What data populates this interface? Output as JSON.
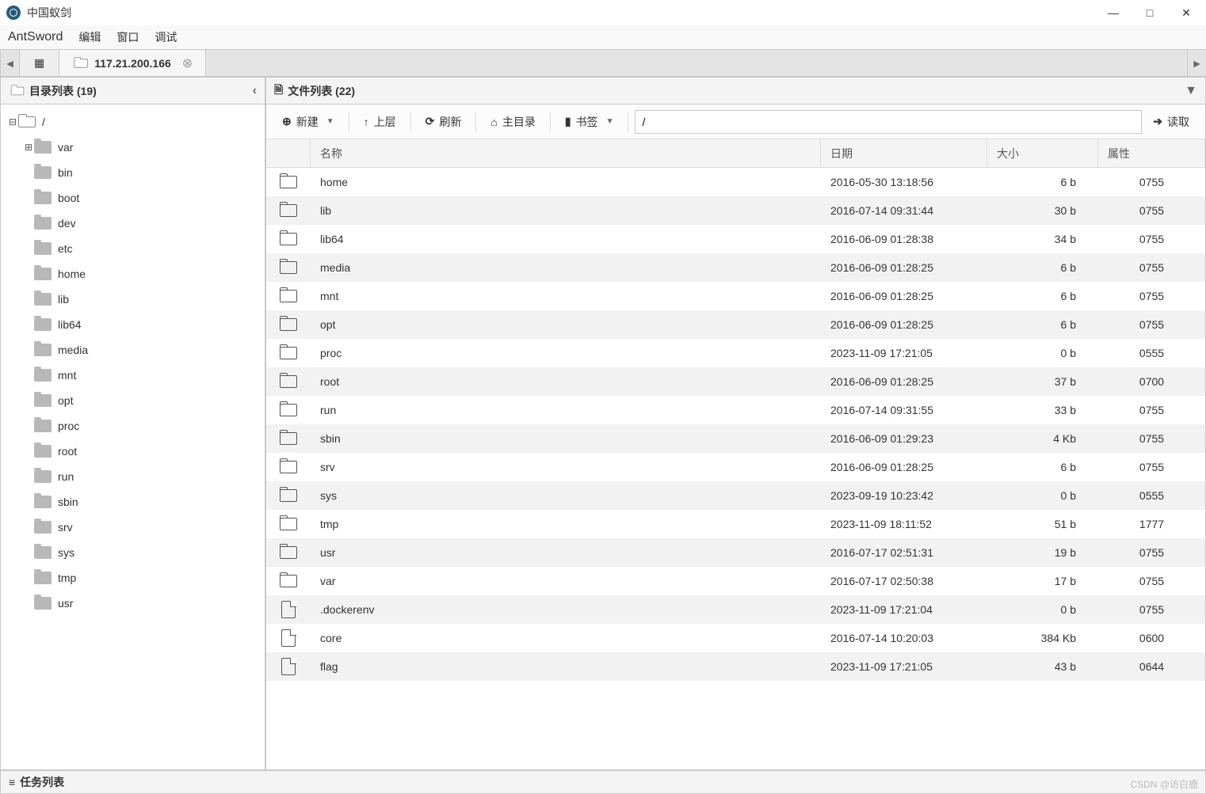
{
  "window": {
    "title": "中国蚁剑",
    "controls": {
      "min": "—",
      "max": "□",
      "close": "✕"
    }
  },
  "menubar": {
    "brand": "AntSword",
    "items": [
      "编辑",
      "窗口",
      "调试"
    ]
  },
  "tabs": {
    "grid_icon": "▦",
    "active": {
      "label": "117.21.200.166"
    },
    "scroll_left": "◄",
    "scroll_right": "►"
  },
  "sidebar": {
    "title": "目录列表 (19)",
    "collapse_glyph": "‹",
    "root": {
      "label": "/",
      "expander": "⊟"
    },
    "items": [
      {
        "label": "var",
        "expander": "⊞"
      },
      {
        "label": "bin"
      },
      {
        "label": "boot"
      },
      {
        "label": "dev"
      },
      {
        "label": "etc"
      },
      {
        "label": "home"
      },
      {
        "label": "lib"
      },
      {
        "label": "lib64"
      },
      {
        "label": "media"
      },
      {
        "label": "mnt"
      },
      {
        "label": "opt"
      },
      {
        "label": "proc"
      },
      {
        "label": "root"
      },
      {
        "label": "run"
      },
      {
        "label": "sbin"
      },
      {
        "label": "srv"
      },
      {
        "label": "sys"
      },
      {
        "label": "tmp"
      },
      {
        "label": "usr"
      }
    ]
  },
  "main": {
    "title": "文件列表 (22)",
    "toolbar": {
      "new": "新建",
      "up": "上层",
      "refresh": "刷新",
      "home": "主目录",
      "bookmark": "书签",
      "path_value": "/",
      "read": "读取",
      "caret": "▼",
      "arrow_right": "➔"
    },
    "columns": {
      "name": "名称",
      "date": "日期",
      "size": "大小",
      "attr": "属性"
    },
    "files": [
      {
        "type": "dir",
        "name": "home",
        "date": "2016-05-30 13:18:56",
        "size": "6 b",
        "attr": "0755"
      },
      {
        "type": "dir",
        "name": "lib",
        "date": "2016-07-14 09:31:44",
        "size": "30 b",
        "attr": "0755"
      },
      {
        "type": "dir",
        "name": "lib64",
        "date": "2016-06-09 01:28:38",
        "size": "34 b",
        "attr": "0755"
      },
      {
        "type": "dir",
        "name": "media",
        "date": "2016-06-09 01:28:25",
        "size": "6 b",
        "attr": "0755"
      },
      {
        "type": "dir",
        "name": "mnt",
        "date": "2016-06-09 01:28:25",
        "size": "6 b",
        "attr": "0755"
      },
      {
        "type": "dir",
        "name": "opt",
        "date": "2016-06-09 01:28:25",
        "size": "6 b",
        "attr": "0755"
      },
      {
        "type": "dir",
        "name": "proc",
        "date": "2023-11-09 17:21:05",
        "size": "0 b",
        "attr": "0555"
      },
      {
        "type": "dir",
        "name": "root",
        "date": "2016-06-09 01:28:25",
        "size": "37 b",
        "attr": "0700"
      },
      {
        "type": "dir",
        "name": "run",
        "date": "2016-07-14 09:31:55",
        "size": "33 b",
        "attr": "0755"
      },
      {
        "type": "dir",
        "name": "sbin",
        "date": "2016-06-09 01:29:23",
        "size": "4 Kb",
        "attr": "0755"
      },
      {
        "type": "dir",
        "name": "srv",
        "date": "2016-06-09 01:28:25",
        "size": "6 b",
        "attr": "0755"
      },
      {
        "type": "dir",
        "name": "sys",
        "date": "2023-09-19 10:23:42",
        "size": "0 b",
        "attr": "0555"
      },
      {
        "type": "dir",
        "name": "tmp",
        "date": "2023-11-09 18:11:52",
        "size": "51 b",
        "attr": "1777"
      },
      {
        "type": "dir",
        "name": "usr",
        "date": "2016-07-17 02:51:31",
        "size": "19 b",
        "attr": "0755"
      },
      {
        "type": "dir",
        "name": "var",
        "date": "2016-07-17 02:50:38",
        "size": "17 b",
        "attr": "0755"
      },
      {
        "type": "file",
        "name": ".dockerenv",
        "date": "2023-11-09 17:21:04",
        "size": "0 b",
        "attr": "0755"
      },
      {
        "type": "file",
        "name": "core",
        "date": "2016-07-14 10:20:03",
        "size": "384 Kb",
        "attr": "0600"
      },
      {
        "type": "file",
        "name": "flag",
        "date": "2023-11-09 17:21:05",
        "size": "43 b",
        "attr": "0644"
      }
    ]
  },
  "bottom": {
    "title": "任务列表"
  },
  "watermark": "CSDN @访白鹿",
  "icons": {
    "plus_circle": "⊕",
    "arrow_up": "↑",
    "refresh": "↻",
    "home": "⌂",
    "bookmark": "▮",
    "file_small": "🗎",
    "list": "≡"
  }
}
